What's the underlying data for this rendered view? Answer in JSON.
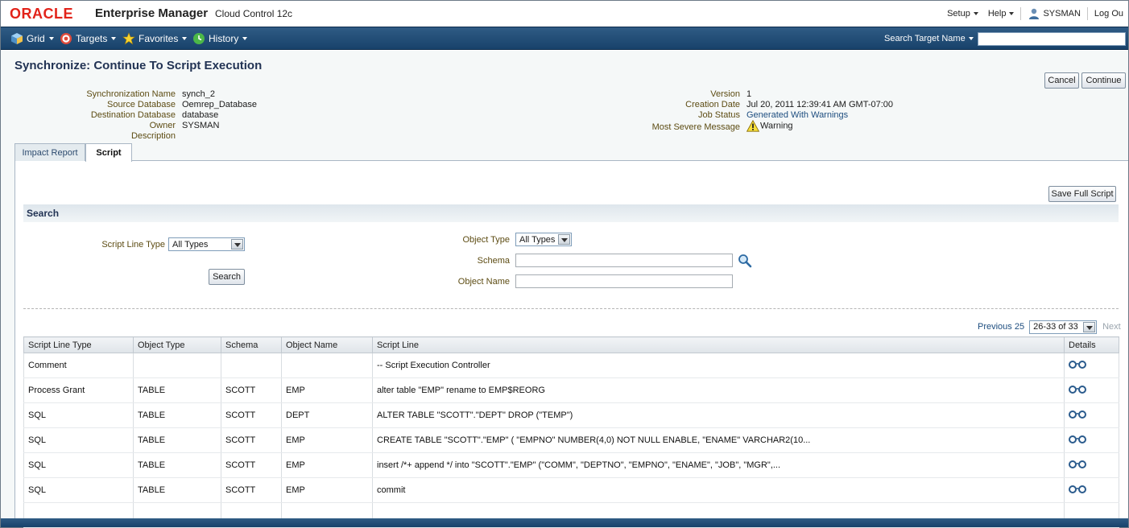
{
  "brand": {
    "oracle": "ORACLE",
    "product": "Enterprise Manager",
    "edition": "Cloud Control 12c"
  },
  "global_nav": {
    "setup": "Setup",
    "help": "Help",
    "user": "SYSMAN",
    "logout": "Log Ou"
  },
  "menu": {
    "grid": "Grid",
    "targets": "Targets",
    "favorites": "Favorites",
    "history": "History",
    "search_target_label": "Search Target Name",
    "search_target_value": ""
  },
  "page": {
    "title": "Synchronize: Continue To Script Execution",
    "cancel_label": "Cancel",
    "continue_label": "Continue"
  },
  "info_left": {
    "sync_name_label": "Synchronization Name",
    "sync_name": "synch_2",
    "source_db_label": "Source Database",
    "source_db": "Oemrep_Database",
    "dest_db_label": "Destination Database",
    "dest_db": "database",
    "owner_label": "Owner",
    "owner": "SYSMAN",
    "description_label": "Description",
    "description": ""
  },
  "info_right": {
    "version_label": "Version",
    "version": "1",
    "creation_label": "Creation Date",
    "creation": "Jul 20, 2011 12:39:41 AM GMT-07:00",
    "job_status_label": "Job Status",
    "job_status": "Generated With Warnings",
    "severe_label": "Most Severe Message",
    "severe": "Warning"
  },
  "tabs": {
    "impact_report": "Impact Report",
    "script": "Script"
  },
  "script_panel": {
    "save_full_script": "Save Full Script",
    "search_header": "Search",
    "script_line_type_label": "Script Line Type",
    "script_line_type_value": "All Types",
    "search_button": "Search",
    "object_type_label": "Object Type",
    "object_type_value": "All Types",
    "schema_label": "Schema",
    "schema_value": "",
    "object_name_label": "Object Name",
    "object_name_value": ""
  },
  "pager": {
    "previous": "Previous 25",
    "range": "26-33 of 33",
    "next": "Next"
  },
  "table": {
    "headers": [
      "Script Line Type",
      "Object Type",
      "Schema",
      "Object Name",
      "Script Line",
      "Details"
    ],
    "rows": [
      [
        "Comment",
        "",
        "",
        "",
        "-- Script Execution Controller"
      ],
      [
        "Process Grant",
        "TABLE",
        "SCOTT",
        "EMP",
        "alter table \"EMP\" rename to EMP$REORG"
      ],
      [
        "SQL",
        "TABLE",
        "SCOTT",
        "DEPT",
        "ALTER TABLE \"SCOTT\".\"DEPT\" DROP (\"TEMP\")"
      ],
      [
        "SQL",
        "TABLE",
        "SCOTT",
        "EMP",
        "CREATE TABLE \"SCOTT\".\"EMP\" ( \"EMPNO\" NUMBER(4,0) NOT NULL ENABLE, \"ENAME\" VARCHAR2(10..."
      ],
      [
        "SQL",
        "TABLE",
        "SCOTT",
        "EMP",
        "insert /*+ append */ into \"SCOTT\".\"EMP\" (\"COMM\", \"DEPTNO\", \"EMPNO\", \"ENAME\", \"JOB\", \"MGR\",..."
      ],
      [
        "SQL",
        "TABLE",
        "SCOTT",
        "EMP",
        "commit"
      ],
      [
        "",
        "",
        "",
        "",
        ""
      ]
    ]
  },
  "icons": {
    "details": "glasses-icon",
    "schema_search": "magnifier-icon",
    "warning": "warning-icon"
  },
  "colors": {
    "menubar": "#1f4a74",
    "label": "#5d4c13",
    "title": "#223354",
    "brand_red": "#e2231a"
  }
}
